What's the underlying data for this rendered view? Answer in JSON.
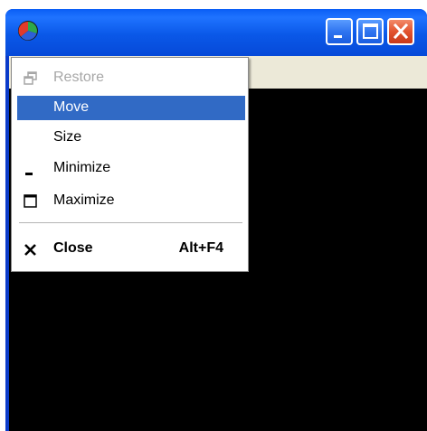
{
  "window": {
    "title": "",
    "icon": "app-pie-icon",
    "buttons": [
      "minimize-icon",
      "maximize-icon",
      "close-icon"
    ],
    "client_color": "#000000",
    "titlebar_color": "#0a58e8",
    "close_button_color": "#e2532e"
  },
  "system_menu": {
    "items": [
      {
        "label": "Restore",
        "icon": "restore-icon",
        "state": "disabled"
      },
      {
        "label": "Move",
        "icon": "",
        "state": "selected"
      },
      {
        "label": "Size",
        "icon": "",
        "state": "normal"
      },
      {
        "label": "Minimize",
        "icon": "minimize-icon",
        "state": "normal"
      },
      {
        "label": "Maximize",
        "icon": "maximize-icon",
        "state": "normal"
      },
      {
        "label": "Close",
        "icon": "close-x-icon",
        "state": "normal",
        "shortcut": "Alt+F4"
      }
    ],
    "highlight_color": "#316ac5",
    "disabled_color": "#a7a7a7"
  }
}
